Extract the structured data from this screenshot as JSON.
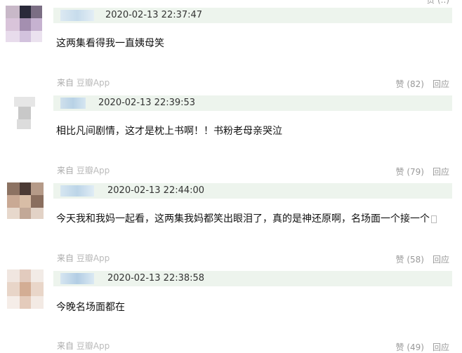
{
  "comments": [
    {
      "timestamp": "2020-02-13 22:37:47",
      "content": "这两集看得我一直姨母笑",
      "source_prefix": "来自",
      "source_app": "豆瓣App",
      "like_label": "赞",
      "like_count": "(82)",
      "reply_label": "回应"
    },
    {
      "timestamp": "2020-02-13 22:39:53",
      "content": "相比凡间剧情，这才是枕上书啊！！书粉老母亲哭泣",
      "source_prefix": "来自",
      "source_app": "豆瓣App",
      "like_label": "赞",
      "like_count": "(79)",
      "reply_label": "回应"
    },
    {
      "timestamp": "2020-02-13 22:44:00",
      "content": "今天我和我妈一起看，这两集我妈都笑出眼泪了，真的是神还原啊，名场面一个接一个",
      "source_prefix": "来自",
      "source_app": "豆瓣App",
      "like_label": "赞",
      "like_count": "(58)",
      "reply_label": "回应"
    },
    {
      "timestamp": "2020-02-13 22:38:58",
      "content": "今晚名场面都在",
      "source_prefix": "来自",
      "source_app": "豆瓣App",
      "like_label": "赞",
      "like_count": "(49)",
      "reply_label": "回应"
    }
  ],
  "colors": {
    "header_bg": "#edf4ed",
    "muted_text": "#999999",
    "source_text": "#aaaaaa"
  }
}
